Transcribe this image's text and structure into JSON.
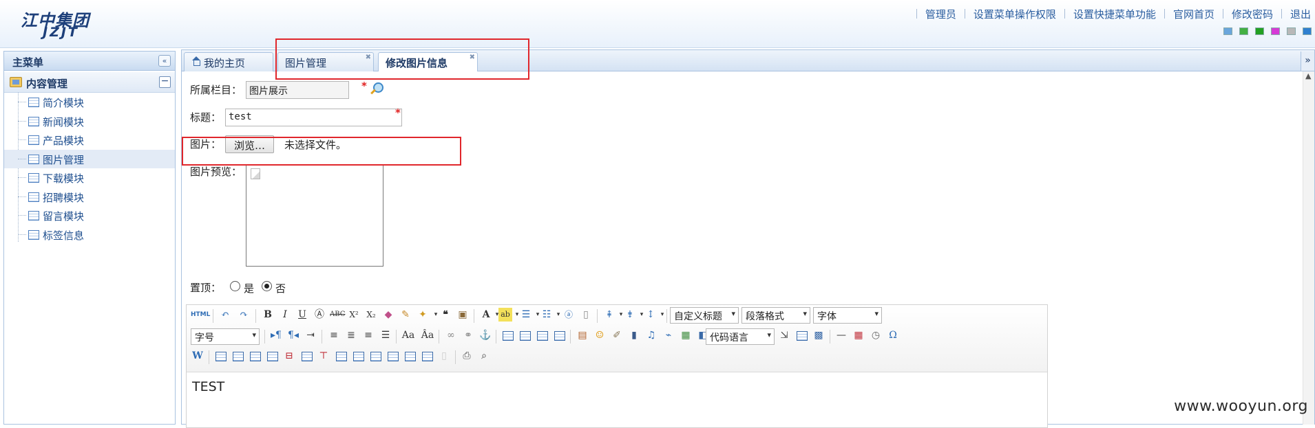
{
  "header": {
    "logo_cn": "江中集团",
    "logo_en": "JZJT",
    "links": [
      "管理员",
      "设置菜单操作权限",
      "设置快捷菜单功能",
      "官网首页",
      "修改密码",
      "退出"
    ],
    "swatch_colors": [
      "#6aa6dc",
      "#43b043",
      "#22a022",
      "#d63ad6",
      "#b8b8b8",
      "#2f80d0"
    ]
  },
  "sidebar": {
    "title": "主菜单",
    "group": "内容管理",
    "items": [
      {
        "label": "简介模块"
      },
      {
        "label": "新闻模块"
      },
      {
        "label": "产品模块"
      },
      {
        "label": "图片管理",
        "active": true
      },
      {
        "label": "下载模块"
      },
      {
        "label": "招聘模块"
      },
      {
        "label": "留言模块"
      },
      {
        "label": "标签信息"
      }
    ]
  },
  "tabs": [
    {
      "label": "我的主页"
    },
    {
      "label": "图片管理"
    },
    {
      "label": "修改图片信息",
      "active": true
    }
  ],
  "form": {
    "category_label": "所属栏目：",
    "category_value": "图片展示",
    "title_label": "标题：",
    "title_value": "test",
    "image_label": "图片：",
    "browse_label": "浏览…",
    "no_file_text": "未选择文件。",
    "preview_label": "图片预览：",
    "top_label": "置顶：",
    "top_yes": "是",
    "top_no": "否",
    "top_selected": "否"
  },
  "editor": {
    "html_btn": "HTML",
    "custom_heading": "自定义标题",
    "paragraph_format": "段落格式",
    "font_family": "字体",
    "font_size": "字号",
    "code_language": "代码语言",
    "body_text": "TEST"
  },
  "watermark": "www.wooyun.org"
}
